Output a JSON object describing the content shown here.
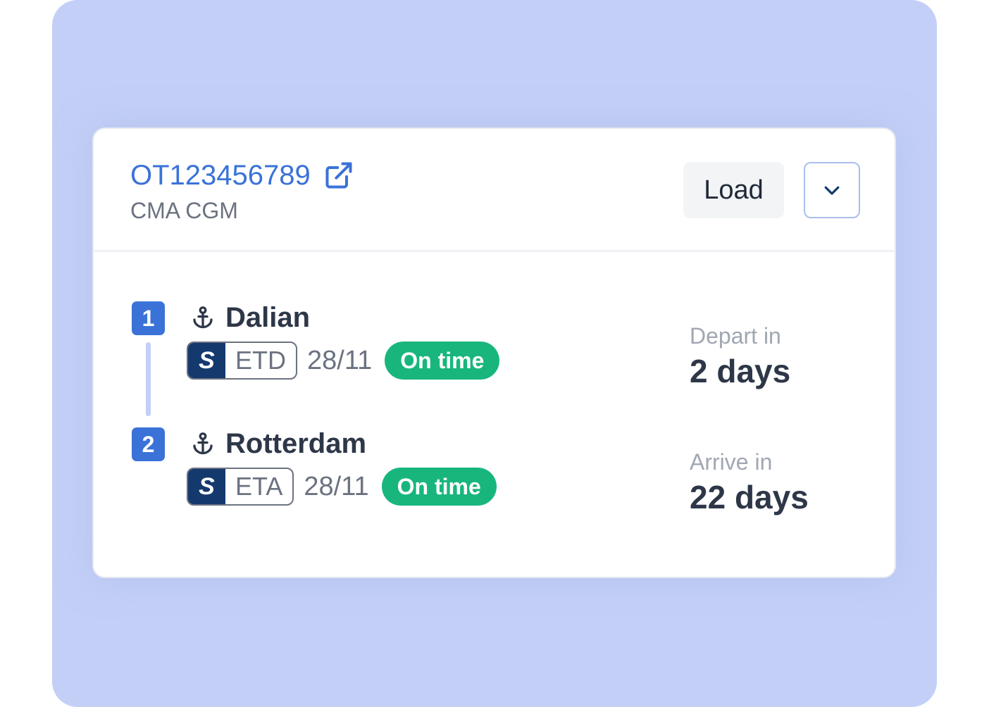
{
  "shipment": {
    "reference": "OT123456789",
    "carrier": "CMA CGM",
    "type_badge": "Load",
    "accent_color": "#3a72d8"
  },
  "route": {
    "stops": [
      {
        "index": "1",
        "port": "Dalian",
        "event_type": "ETD",
        "date": "28/11",
        "status": "On time",
        "countdown_label": "Depart in",
        "countdown_value": "2 days"
      },
      {
        "index": "2",
        "port": "Rotterdam",
        "event_type": "ETA",
        "date": "28/11",
        "status": "On time",
        "countdown_label": "Arrive in",
        "countdown_value": "22 days"
      }
    ],
    "status_color": "#18b67c",
    "source_logo_letter": "S"
  },
  "icons": {
    "external_link": "external-link-icon",
    "dropdown": "chevron-down-icon",
    "port": "anchor-icon"
  }
}
